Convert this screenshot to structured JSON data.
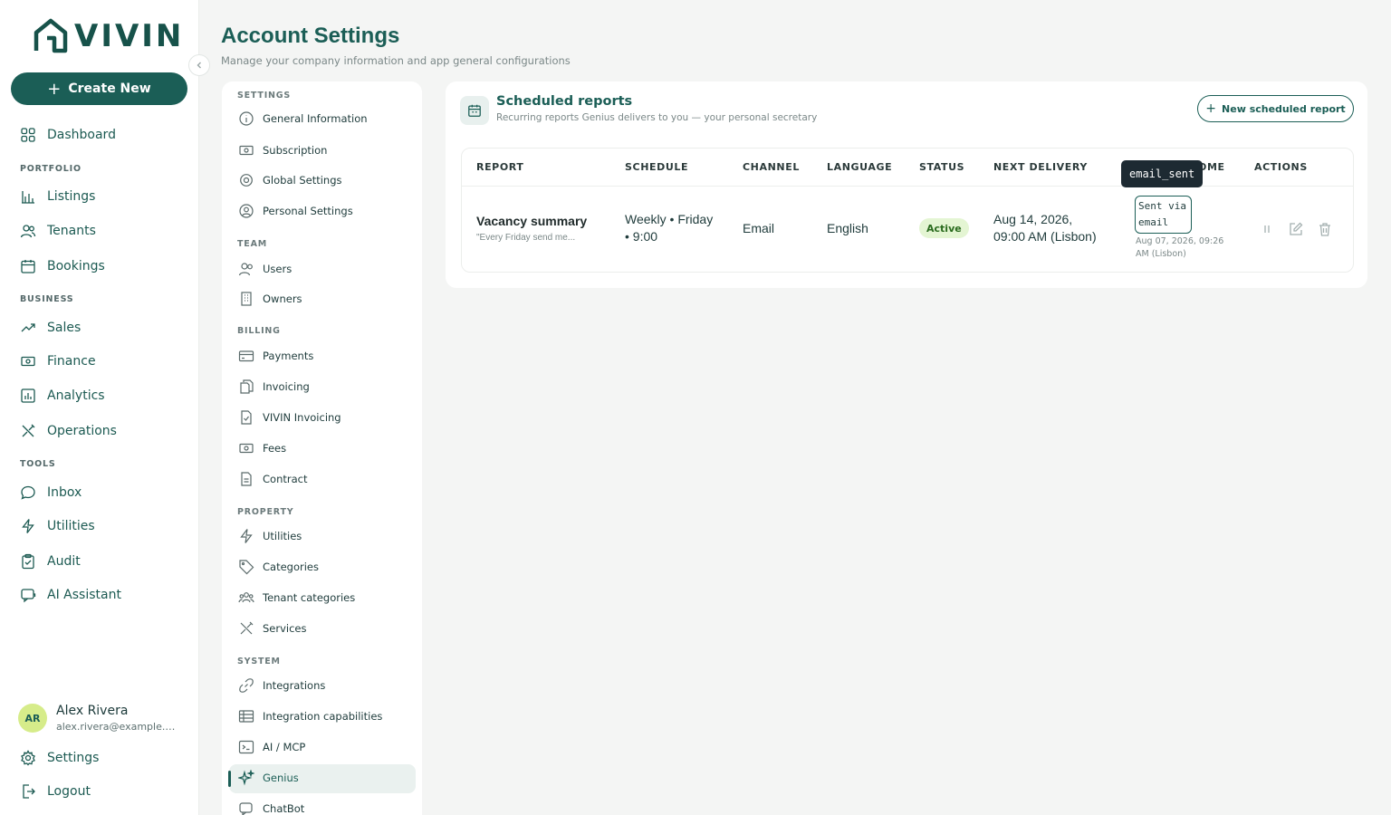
{
  "brand": {
    "logo_text": "VIVIN"
  },
  "leftnav": {
    "create_label": "Create New",
    "items": {
      "dashboard": "Dashboard",
      "listings": "Listings",
      "tenants": "Tenants",
      "bookings": "Bookings",
      "sales": "Sales",
      "finance": "Finance",
      "analytics": "Analytics",
      "operations": "Operations",
      "inbox": "Inbox",
      "utilities": "Utilities",
      "audit": "Audit",
      "ai_assistant": "AI Assistant",
      "settings": "Settings",
      "logout": "Logout"
    },
    "sections": {
      "portfolio": "PORTFOLIO",
      "business": "BUSINESS",
      "tools": "TOOLS"
    }
  },
  "user": {
    "initials": "AR",
    "name": "Alex Rivera",
    "email": "alex.rivera@example.com"
  },
  "header": {
    "title": "Account Settings",
    "subtitle": "Manage your company information and app general configurations"
  },
  "settings_menu": {
    "sections": {
      "settings": "SETTINGS",
      "team": "TEAM",
      "billing": "BILLING",
      "property": "PROPERTY",
      "system": "SYSTEM"
    },
    "items": {
      "general_information": "General Information",
      "subscription": "Subscription",
      "global_settings": "Global Settings",
      "personal_settings": "Personal Settings",
      "users": "Users",
      "owners": "Owners",
      "payments": "Payments",
      "invoicing": "Invoicing",
      "vivin_invoicing": "VIVIN Invoicing",
      "fees": "Fees",
      "contract": "Contract",
      "utilities": "Utilities",
      "categories": "Categories",
      "tenant_categories": "Tenant categories",
      "services": "Services",
      "integrations": "Integrations",
      "integration_capabilities": "Integration capabilities",
      "ai_mcp": "AI / MCP",
      "genius": "Genius",
      "chatbot": "ChatBot"
    },
    "active": "Genius"
  },
  "scheduled_reports": {
    "title": "Scheduled reports",
    "subtitle": "Recurring reports Genius delivers to you — your personal secretary",
    "new_button": "New scheduled report",
    "columns": {
      "report": "REPORT",
      "schedule": "SCHEDULE",
      "channel": "CHANNEL",
      "language": "LANGUAGE",
      "status": "STATUS",
      "next_delivery": "NEXT DELIVERY",
      "outcome": "OME",
      "actions": "ACTIONS"
    },
    "rows": [
      {
        "name": "Vacancy summary",
        "description": "\"Every Friday send me...",
        "schedule_line1": "Weekly • Friday",
        "schedule_line2": "• 9:00",
        "channel": "Email",
        "language": "English",
        "status": "Active",
        "next_delivery_line1": "Aug 14, 2026,",
        "next_delivery_line2": "09:00 AM (Lisbon)",
        "outcome_line1": "Sent via",
        "outcome_line2": "email",
        "outcome_date_line1": "Aug 07, 2026, 09:26",
        "outcome_date_line2": "AM (Lisbon)"
      }
    ],
    "tooltip": "email_sent"
  },
  "colors": {
    "brand": "#1b5e56",
    "accent": "#d6ec8a",
    "status_active_bg": "#e4f5d3"
  }
}
